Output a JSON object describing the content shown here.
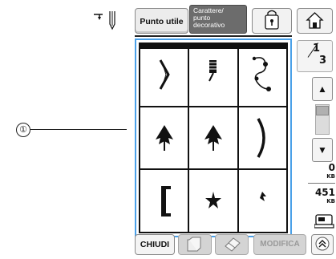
{
  "callout": {
    "number": "①"
  },
  "header": {
    "tab_utility": "Punto utile",
    "tab_character_lines": [
      "Carattere/",
      "punto",
      "decorativo"
    ]
  },
  "pagination": {
    "current": "1",
    "total": "3"
  },
  "memory": {
    "used_value": "0",
    "used_unit": "KB",
    "free_value": "451",
    "free_unit": "KB"
  },
  "footer": {
    "close_label": "CHIUDI",
    "edit_label": "MODIFICA"
  },
  "stitches": [
    {
      "icon": "bracket-right-stitch-icon"
    },
    {
      "icon": "zigzag-bar-stitch-icon"
    },
    {
      "icon": "scroll-vine-stitch-icon"
    },
    {
      "icon": "leaf-stitch-icon"
    },
    {
      "icon": "leaf-stitch-icon"
    },
    {
      "icon": "arc-stitch-icon"
    },
    {
      "icon": "bracket-left-stitch-icon"
    },
    {
      "icon": "star-stitch-icon"
    },
    {
      "icon": "small-leaf-stitch-icon"
    }
  ],
  "colors": {
    "selection_border": "#4aa0e8",
    "active_tab": "#6c6c6c"
  }
}
